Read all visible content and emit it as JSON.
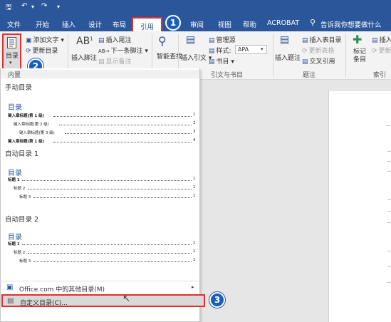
{
  "quick_access": {
    "save_icon": "save-icon",
    "undo_icon": "undo-icon",
    "redo_icon": "redo-icon",
    "more_icon": "customize-icon"
  },
  "tabs": [
    "文件",
    "开始",
    "插入",
    "设计",
    "布局",
    "引用",
    "审阅",
    "视图",
    "帮助",
    "ACROBAT"
  ],
  "active_tab": "引用",
  "tell_me": "告诉我你想要做什么",
  "ribbon": {
    "toc": {
      "button": "目录",
      "add_text": "添加文字",
      "update": "更新目录"
    },
    "footnotes": {
      "insert_footnote": "插入脚注",
      "insert_endnote": "插入尾注",
      "next_footnote": "下一条脚注",
      "show_notes": "显示备注",
      "ab_label": "AB"
    },
    "research": {
      "smart_lookup": "智能查找"
    },
    "citations": {
      "insert_citation": "插入引文",
      "manage_sources": "管理源",
      "style_label": "样式:",
      "style_value": "APA",
      "bibliography": "书目",
      "group": "引文与书目"
    },
    "captions": {
      "insert_caption": "插入题注",
      "insert_table_of_figures": "插入表目录",
      "update_table": "更新表格",
      "cross_reference": "交叉引用",
      "group": "题注"
    },
    "index": {
      "mark_entry": "标记条目",
      "insert": "插入",
      "update": "更新",
      "group": "索引"
    }
  },
  "dropdown": {
    "header": "内置",
    "manual": {
      "name": "手动目录",
      "title": "目录",
      "entries": [
        {
          "text": "键入章标题(第 1 级)",
          "page": "1"
        },
        {
          "text": "键入章标题(第 2 级)",
          "page": "2"
        },
        {
          "text": "键入章标题(第 3 级)",
          "page": "3"
        },
        {
          "text": "键入章标题(第 1 级)",
          "page": "4"
        }
      ]
    },
    "auto1": {
      "name": "自动目录 1",
      "title": "目录",
      "entries": [
        {
          "text": "标题 1",
          "page": "1"
        },
        {
          "text": "标题 2",
          "page": "1"
        },
        {
          "text": "标题 3",
          "page": "1"
        }
      ]
    },
    "auto2": {
      "name": "自动目录 2",
      "title": "目录",
      "entries": [
        {
          "text": "标题 1",
          "page": "1"
        },
        {
          "text": "标题 2",
          "page": "1"
        },
        {
          "text": "标题 3",
          "page": "1"
        }
      ]
    },
    "office_more": "Office.com 中的其他目录(M)",
    "custom": "自定义目录(C)..."
  },
  "annotations": [
    "1",
    "2",
    "3"
  ],
  "colors": {
    "accent": "#2b579a",
    "highlight": "#e03030",
    "badge": "#1c5fb8"
  }
}
